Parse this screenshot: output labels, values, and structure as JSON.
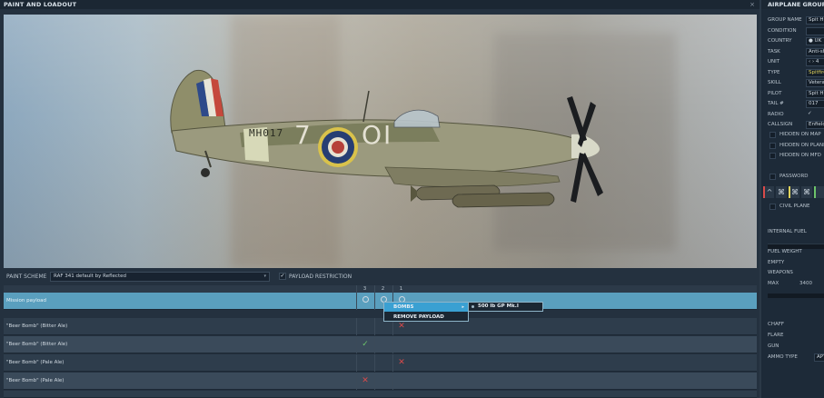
{
  "left_panel": {
    "title": "PAINT AND LOADOUT",
    "close_glyph": "×",
    "paint_scheme_label": "PAINT SCHEME",
    "paint_scheme_value": "RAF 341 default by Reflected",
    "payload_restriction_label": "PAYLOAD RESTRICTION",
    "payload_restriction_checked": "✓",
    "aircraft_markings": {
      "code": "MH017",
      "roundel_left": "7",
      "roundel_right": "OI"
    }
  },
  "grid": {
    "columns": [
      "3",
      "2",
      "1"
    ],
    "rows": [
      {
        "name": "Mission payload",
        "cells": [
          "circ",
          "circ",
          "circ"
        ]
      },
      {
        "name": "\"Beer Bomb\" (Bitter Ale)",
        "cells": [
          "",
          "",
          "no"
        ]
      },
      {
        "name": "\"Beer Bomb\" (Bitter Ale)",
        "cells": [
          "ok",
          "",
          ""
        ]
      },
      {
        "name": "\"Beer Bomb\" (Pale Ale)",
        "cells": [
          "",
          "",
          "no"
        ]
      },
      {
        "name": "\"Beer Bomb\" (Pale Ale)",
        "cells": [
          "no",
          "",
          ""
        ]
      }
    ]
  },
  "context_menu": {
    "items": [
      {
        "label": "BOMBS",
        "submenu": "▸"
      },
      {
        "label": "REMOVE PAYLOAD",
        "submenu": ""
      }
    ],
    "submenu_item": "500 lb GP Mk.I"
  },
  "right_panel": {
    "title": "AIRPLANE GROUP",
    "fields": [
      {
        "label": "GROUP NAME",
        "value": "Spit Hu"
      },
      {
        "label": "CONDITION",
        "value": ""
      },
      {
        "label": "COUNTRY",
        "value": "● UK"
      },
      {
        "label": "TASK",
        "value": "Anti-sh"
      },
      {
        "label": "UNIT",
        "value": "‹ › 4"
      },
      {
        "label": "TYPE",
        "value": "Spitfire"
      },
      {
        "label": "SKILL",
        "value": "Vetera"
      },
      {
        "label": "PILOT",
        "value": "Spit Hu"
      },
      {
        "label": "TAIL #",
        "value": "017"
      },
      {
        "label": "RADIO",
        "value": "✓"
      },
      {
        "label": "CALLSIGN",
        "value": "Enfield"
      }
    ],
    "checkboxes": [
      "HIDDEN ON MAP",
      "HIDDEN ON PLANNER",
      "HIDDEN ON MFD"
    ],
    "password_label": "PASSWORD",
    "civil_plane_label": "CIVIL PLANE",
    "internal_fuel_label": "INTERNAL FUEL",
    "weight_labels": [
      "FUEL WEIGHT",
      "EMPTY",
      "WEAPONS",
      "MAX"
    ],
    "max_value": "3400",
    "lower_labels": [
      "CHAFF",
      "FLARE",
      "GUN",
      "AMMO TYPE"
    ],
    "ammo_value": "APT"
  }
}
